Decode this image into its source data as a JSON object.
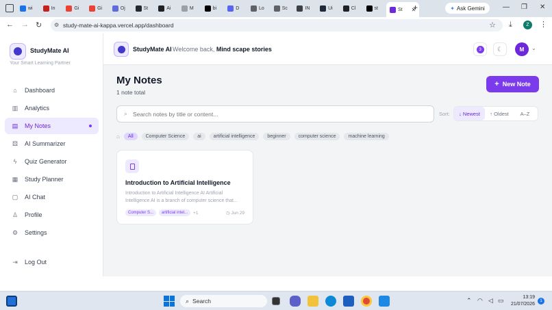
{
  "browser": {
    "tabs": [
      {
        "label": "wi",
        "color": "#1a73e8"
      },
      {
        "label": "In",
        "color": "#c5221f"
      },
      {
        "label": "Gi",
        "color": "#ea4335"
      },
      {
        "label": "Gi",
        "color": "#ea4335"
      },
      {
        "label": "Oj",
        "color": "#5f6dd8"
      },
      {
        "label": "St",
        "color": "#24292f"
      },
      {
        "label": "Ai",
        "color": "#202124"
      },
      {
        "label": "M",
        "color": "#9aa0a6"
      },
      {
        "label": "bi",
        "color": "#000000"
      },
      {
        "label": "D",
        "color": "#5865f2"
      },
      {
        "label": "Lo",
        "color": "#5f6368"
      },
      {
        "label": "Sc",
        "color": "#5f6368"
      },
      {
        "label": "IN",
        "color": "#3c4043"
      },
      {
        "label": "Ui",
        "color": "#1f2937"
      },
      {
        "label": "Cl",
        "color": "#202124"
      },
      {
        "label": "st",
        "color": "#000000"
      }
    ],
    "active_tab": {
      "label": "St"
    },
    "new_tab": "+",
    "gemini_label": "Ask Gemini",
    "window_controls": {
      "minimize": "—",
      "restore": "❐",
      "close": "✕"
    },
    "url": "study-mate-ai-kappa.vercel.app/dashboard",
    "profile_initial": "Z"
  },
  "app": {
    "brand": "StudyMate AI",
    "tagline": "Your Smart Learning Partner",
    "nav": [
      {
        "label": "Dashboard",
        "icon": "home-icon"
      },
      {
        "label": "Analytics",
        "icon": "bar-chart-icon"
      },
      {
        "label": "My Notes",
        "icon": "book-icon",
        "active": true
      },
      {
        "label": "AI Summarizer",
        "icon": "ai-icon"
      },
      {
        "label": "Quiz Generator",
        "icon": "zap-icon"
      },
      {
        "label": "Study Planner",
        "icon": "calendar-icon"
      },
      {
        "label": "AI Chat",
        "icon": "chat-icon"
      },
      {
        "label": "Profile",
        "icon": "user-icon"
      },
      {
        "label": "Settings",
        "icon": "gear-icon"
      }
    ],
    "logout": "Log Out",
    "header": {
      "brand": "StudyMate AI",
      "welcome_prefix": "Welcome back,",
      "user_name": "Mind scape stories",
      "notification_count": "3",
      "avatar_initial": "M"
    }
  },
  "main": {
    "title": "My Notes",
    "count": "1 note total",
    "new_note": "New Note",
    "search_placeholder": "Search notes by title or content...",
    "sort_label": "Sort:",
    "sort_options": [
      {
        "label": "↓ Newest",
        "active": true
      },
      {
        "label": "↑ Oldest",
        "active": false
      },
      {
        "label": "A–Z",
        "active": false
      }
    ],
    "tags": [
      "All",
      "Computer Science",
      "ai",
      "artificial intelligence",
      "beginner",
      "computer science",
      "machine learning"
    ],
    "note": {
      "title": "Introduction to Artificial Intelligence",
      "excerpt": "Introduction to Artificial Intelligence AI Artificial Intelligence AI is a branch of computer science that...",
      "tags": [
        "Computer S...",
        "artificial intel..."
      ],
      "more": "+1",
      "date": "Jun 29"
    }
  },
  "taskbar": {
    "search": "Search",
    "time": "13:19",
    "date": "21/07/2026"
  }
}
